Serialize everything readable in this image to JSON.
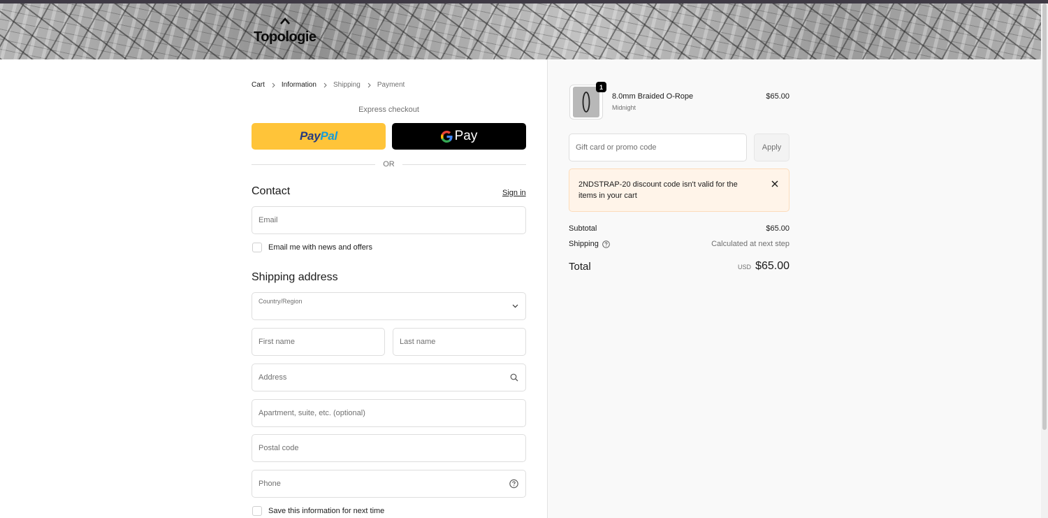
{
  "brand": {
    "name": "Topologie"
  },
  "breadcrumb": {
    "items": [
      {
        "label": "Cart"
      },
      {
        "label": "Information"
      },
      {
        "label": "Shipping"
      },
      {
        "label": "Payment"
      }
    ]
  },
  "express": {
    "title": "Express checkout",
    "paypal": {
      "label_a": "Pay",
      "label_b": "Pal"
    },
    "gpay": {
      "label": "Pay"
    },
    "divider": "OR"
  },
  "contact": {
    "title": "Contact",
    "signin": "Sign in",
    "email_placeholder": "Email",
    "newsletter_label": "Email me with news and offers"
  },
  "shipping_address": {
    "title": "Shipping address",
    "country_label": "Country/Region",
    "country_value": "",
    "first_name": "First name",
    "last_name": "Last name",
    "address": "Address",
    "apartment": "Apartment, suite, etc. (optional)",
    "postal_code": "Postal code",
    "phone": "Phone",
    "save_info_label": "Save this information for next time"
  },
  "order": {
    "item": {
      "quantity": "1",
      "name": "8.0mm Braided O-Rope",
      "variant": "Midnight",
      "price": "$65.00"
    },
    "promo_placeholder": "Gift card or promo code",
    "apply_label": "Apply",
    "alert": "2NDSTRAP-20 discount code isn't valid for the items in your cart",
    "subtotal_label": "Subtotal",
    "subtotal_value": "$65.00",
    "shipping_label": "Shipping",
    "shipping_value": "Calculated at next step",
    "total_label": "Total",
    "total_currency": "USD",
    "total_value": "$65.00"
  },
  "icons": {
    "logo": "caret-up-icon",
    "breadcrumb_separator": "chevron-right-icon",
    "country_select": "chevron-down-icon",
    "address_search": "search-icon",
    "phone_help": "question-circle-icon",
    "shipping_help": "question-circle-icon",
    "alert_close": "close-icon",
    "gpay": "google-g-icon"
  },
  "colors": {
    "paypal_button": "#ffc439",
    "paypal_dark": "#253b80",
    "paypal_light": "#179bd7",
    "gpay_button": "#000000",
    "alert_bg": "#fff4e9",
    "alert_border": "#fcdcbb",
    "summary_bg": "#f9f9f9"
  }
}
